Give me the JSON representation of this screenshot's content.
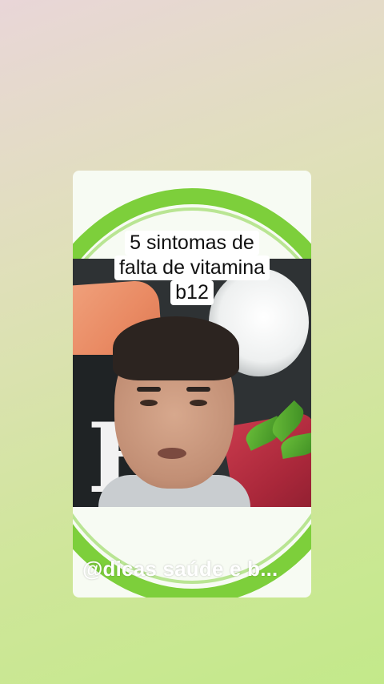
{
  "video": {
    "caption_lines": [
      "5 sintomas de",
      "falta de vitamina",
      "b12"
    ],
    "author_overlay": "@dicas saúde e b...",
    "background_letter": "B"
  },
  "colors": {
    "accent_green": "#7dcf3b",
    "caption_background": "#ffffff",
    "page_gradient_start": "#e9d6d8",
    "page_gradient_end": "#c3e98a"
  }
}
